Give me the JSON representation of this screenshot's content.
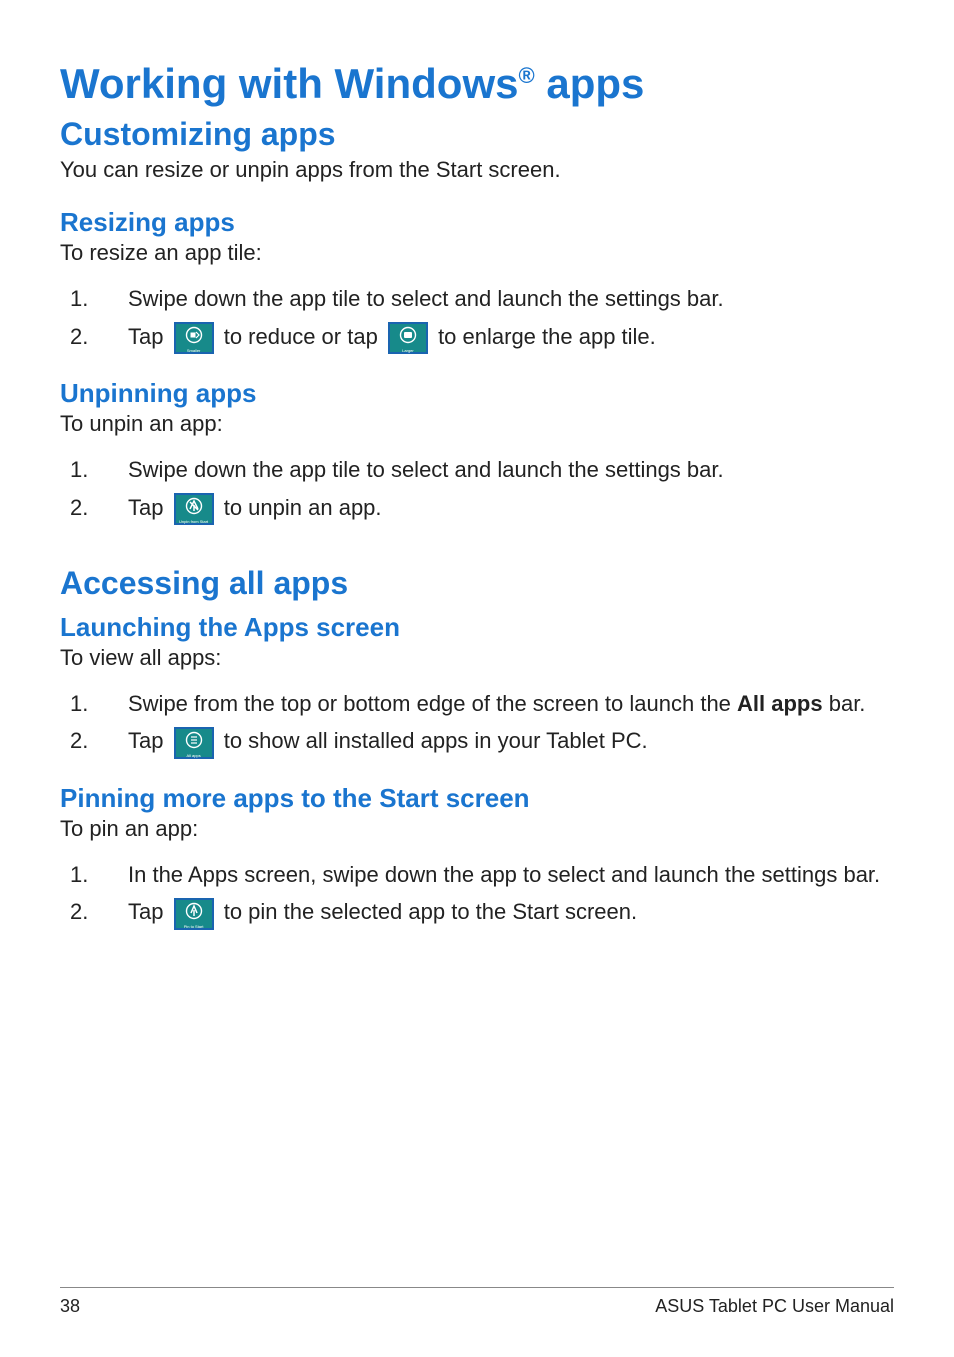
{
  "title_pre": "Working with Windows",
  "title_sup": "®",
  "title_post": " apps",
  "sections": {
    "customizing": {
      "heading": "Customizing apps",
      "intro": "You can resize or unpin apps from the Start screen.",
      "resizing": {
        "heading": "Resizing apps",
        "intro": "To resize an app tile:",
        "step1": "Swipe down the app tile to select and launch the settings bar.",
        "step2_a": "Tap ",
        "step2_b": " to reduce or tap ",
        "step2_c": " to enlarge the app tile.",
        "icon_smaller": "Smaller",
        "icon_larger": "Larger"
      },
      "unpinning": {
        "heading": "Unpinning apps",
        "intro": "To unpin an app:",
        "step1": "Swipe down the app tile to select and launch the settings bar.",
        "step2_a": "Tap ",
        "step2_b": " to unpin an app.",
        "icon_unpin": "Unpin from Start"
      }
    },
    "accessing": {
      "heading": "Accessing all apps",
      "launching": {
        "heading": "Launching the Apps screen",
        "intro": "To view all apps:",
        "step1_a": "Swipe from the top or bottom edge of the screen to launch the ",
        "step1_bold": "All apps",
        "step1_b": " bar.",
        "step2_a": "Tap ",
        "step2_b": " to show all installed apps in your Tablet PC.",
        "icon_allapps": "All apps"
      },
      "pinning": {
        "heading": "Pinning more apps to the Start screen",
        "intro": "To pin an app:",
        "step1": "In the Apps screen, swipe down the app to select and launch the settings bar.",
        "step2_a": "Tap ",
        "step2_b": " to pin the selected app to the Start screen.",
        "icon_pin": "Pin to Start"
      }
    }
  },
  "footer": {
    "page": "38",
    "manual": "ASUS Tablet PC User Manual"
  },
  "nums": {
    "n1": "1.",
    "n2": "2."
  }
}
